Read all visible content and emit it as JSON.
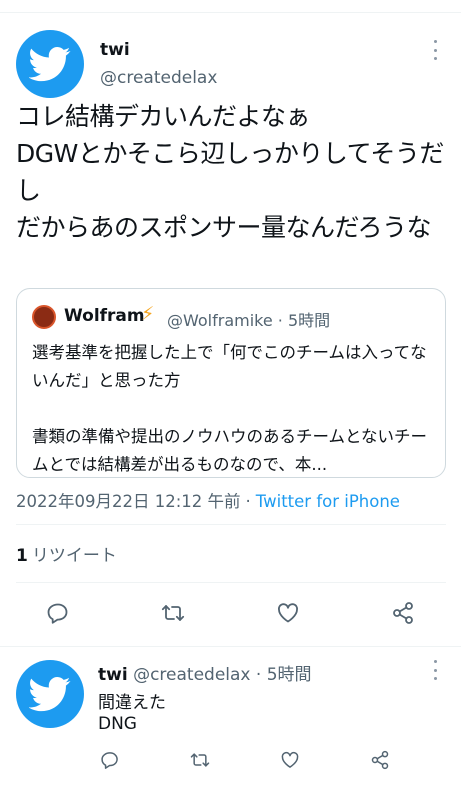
{
  "tweet": {
    "author_name": "twi",
    "author_handle": "@createdelax",
    "text": "コレ結構デカいんだよなぁ\nDGWとかそこら辺しっかりしてそうだし\nだからあのスポンサー量なんだろうな",
    "timestamp": "2022年09月22日 12:12 午前",
    "separator": "·",
    "source": "Twitter for iPhone",
    "retweet_count": "1",
    "retweet_label": "リツイート"
  },
  "quote": {
    "name": "Wolfram",
    "name_emoji": "⚡",
    "meta": "@Wolframike · 5時間",
    "text": "選考基準を把握した上で「何でこのチームは入ってないんだ」と思った方\n\n書類の準備や提出のノウハウのあるチームとないチームとでは結構差が出るものなので、本..."
  },
  "reply": {
    "author_name": "twi",
    "meta": "@createdelax · 5時間",
    "line1": "間違えた",
    "line2": "DNG"
  },
  "icons": {
    "avatar": "twitter-bird-icon",
    "reply": "reply-icon",
    "retweet": "retweet-icon",
    "like": "heart-icon",
    "share": "share-icon",
    "more": "more-icon"
  },
  "colors": {
    "brand": "#1d9bf0",
    "text": "#0f1419",
    "secondary": "#536471",
    "border": "#cfd9de"
  }
}
